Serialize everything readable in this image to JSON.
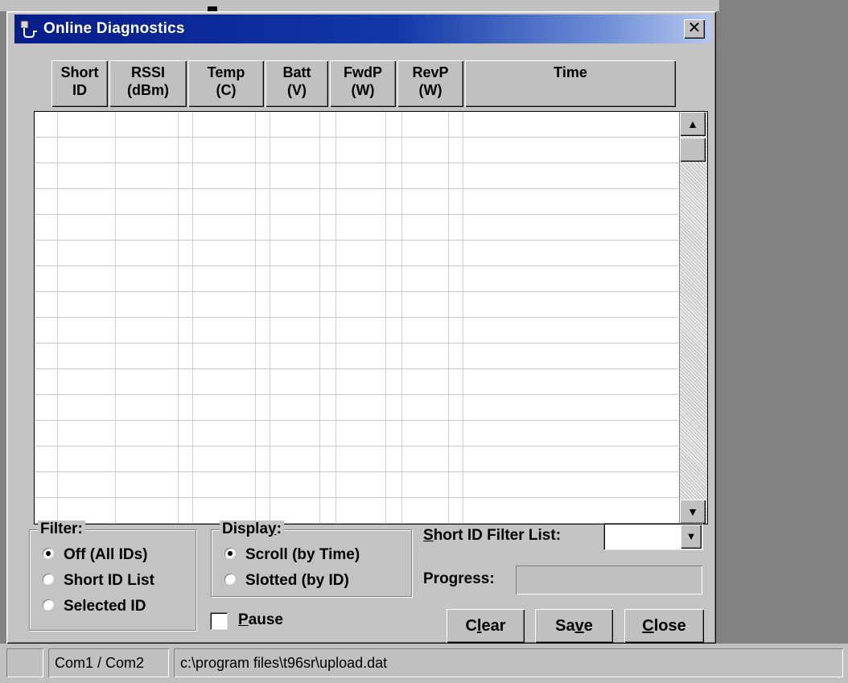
{
  "window": {
    "title": "Online Diagnostics",
    "close_label": "✕"
  },
  "columns": [
    {
      "line1": "Short",
      "line2": "ID"
    },
    {
      "line1": "RSSI",
      "line2": "(dBm)"
    },
    {
      "line1": "Temp",
      "line2": "(C)"
    },
    {
      "line1": "Batt",
      "line2": "(V)"
    },
    {
      "line1": "FwdP",
      "line2": "(W)"
    },
    {
      "line1": "RevP",
      "line2": "(W)"
    },
    {
      "line1": "Time",
      "line2": ""
    }
  ],
  "filter": {
    "title": "Filter:",
    "options": [
      "Off (All IDs)",
      "Short ID List",
      "Selected ID"
    ],
    "selected": 0
  },
  "display": {
    "title_pre": "Displa",
    "title_mn": "y",
    "title_post": ":",
    "options": [
      "Scroll (by Time)",
      "Slotted (by ID)"
    ],
    "selected": 0
  },
  "pause": {
    "pre": "",
    "mn": "P",
    "post": "ause",
    "checked": false
  },
  "short_id_filter": {
    "pre": "",
    "mn": "S",
    "post": "hort ID Filter List:",
    "value": ""
  },
  "progress": {
    "label": "Progress:",
    "value": 0
  },
  "buttons": {
    "clear": {
      "pre": "C",
      "mn": "l",
      "post": "ear"
    },
    "save": {
      "pre": "Sa",
      "mn": "v",
      "post": "e"
    },
    "close": {
      "pre": "",
      "mn": "C",
      "post": "lose"
    }
  },
  "statusbar": {
    "port": "Com1 / Com2",
    "path": "c:\\program files\\t96sr\\upload.dat"
  }
}
